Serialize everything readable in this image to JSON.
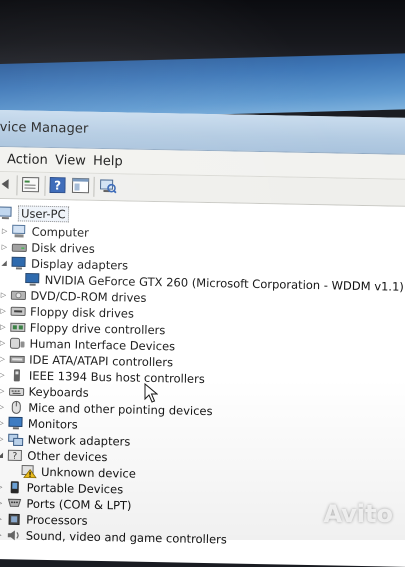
{
  "window": {
    "title": "vice Manager"
  },
  "menu": [
    "Action",
    "View",
    "Help"
  ],
  "toolbar": {
    "icons": [
      "back-icon",
      "properties-icon",
      "help-icon",
      "view-icon",
      "scan-hardware-icon"
    ]
  },
  "tree": {
    "root": "User-PC",
    "items": [
      {
        "label": "Computer",
        "icon": "computer-icon",
        "expanded": false
      },
      {
        "label": "Disk drives",
        "icon": "disk-drive-icon",
        "expanded": false
      },
      {
        "label": "Display adapters",
        "icon": "display-adapter-icon",
        "expanded": true,
        "children": [
          {
            "label": "NVIDIA GeForce GTX 260 (Microsoft Corporation - WDDM v1.1)",
            "icon": "display-adapter-icon"
          }
        ]
      },
      {
        "label": "DVD/CD-ROM drives",
        "icon": "dvd-drive-icon",
        "expanded": false
      },
      {
        "label": "Floppy disk drives",
        "icon": "floppy-icon",
        "expanded": false
      },
      {
        "label": "Floppy drive controllers",
        "icon": "floppy-controller-icon",
        "expanded": false
      },
      {
        "label": "Human Interface Devices",
        "icon": "hid-icon",
        "expanded": false
      },
      {
        "label": "IDE ATA/ATAPI controllers",
        "icon": "ide-controller-icon",
        "expanded": false
      },
      {
        "label": "IEEE 1394 Bus host controllers",
        "icon": "ieee1394-icon",
        "expanded": false
      },
      {
        "label": "Keyboards",
        "icon": "keyboard-icon",
        "expanded": false
      },
      {
        "label": "Mice and other pointing devices",
        "icon": "mouse-icon",
        "expanded": false
      },
      {
        "label": "Monitors",
        "icon": "monitor-icon",
        "expanded": false
      },
      {
        "label": "Network adapters",
        "icon": "network-adapter-icon",
        "expanded": false
      },
      {
        "label": "Other devices",
        "icon": "other-devices-icon",
        "expanded": true,
        "children": [
          {
            "label": "Unknown device",
            "icon": "warning-device-icon"
          }
        ]
      },
      {
        "label": "Portable Devices",
        "icon": "portable-device-icon",
        "expanded": false
      },
      {
        "label": "Ports (COM & LPT)",
        "icon": "port-icon",
        "expanded": false
      },
      {
        "label": "Processors",
        "icon": "processor-icon",
        "expanded": false
      },
      {
        "label": "Sound, video and game controllers",
        "icon": "sound-icon",
        "expanded": false
      }
    ]
  },
  "watermark": {
    "text": "Avito"
  }
}
